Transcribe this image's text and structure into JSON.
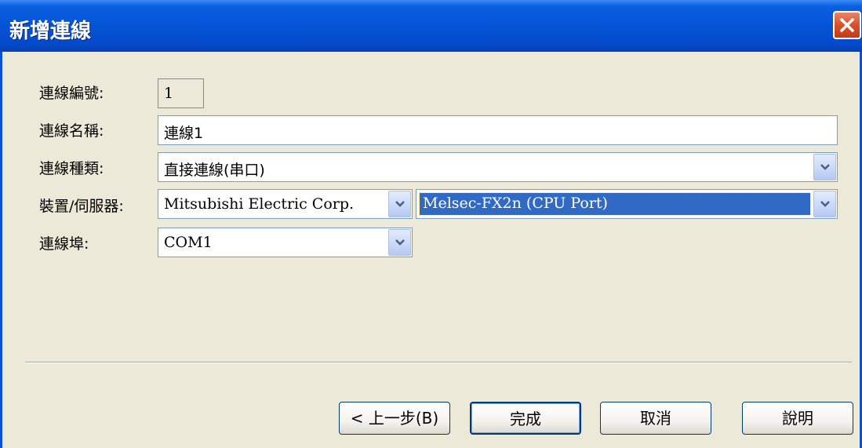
{
  "window": {
    "title": "新增連線",
    "close_icon": "close-icon"
  },
  "form": {
    "connection_number": {
      "label": "連線編號:",
      "value": "1"
    },
    "connection_name": {
      "label": "連線名稱:",
      "value": "連線1"
    },
    "connection_type": {
      "label": "連線種類:",
      "value": "直接連線(串口)"
    },
    "device_server": {
      "label": "裝置/伺服器:",
      "manufacturer": "Mitsubishi Electric Corp.",
      "model": "Melsec-FX2n (CPU Port)"
    },
    "port": {
      "label": "連線埠:",
      "value": "COM1"
    }
  },
  "buttons": {
    "back": "< 上一步(B)",
    "finish": "完成",
    "cancel": "取消",
    "help": "說明"
  },
  "colors": {
    "titlebar": "#0554d6",
    "dialog_bg": "#ece9d8",
    "selection": "#316ac5",
    "close_button": "#d8502c"
  }
}
